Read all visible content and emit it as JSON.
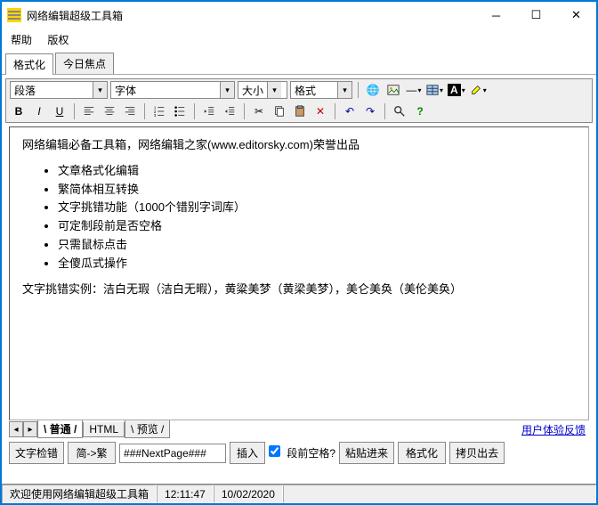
{
  "window": {
    "title": "网络编辑超级工具箱"
  },
  "menu": {
    "help": "帮助",
    "copyright": "版权"
  },
  "top_tabs": {
    "format": "格式化",
    "today": "今日焦点"
  },
  "combos": {
    "paragraph": "段落",
    "font": "字体",
    "size": "大小",
    "style": "格式"
  },
  "content": {
    "intro": "网络编辑必备工具箱，网络编辑之家(www.editorsky.com)荣誉出品",
    "bullets": [
      "文章格式化编辑",
      "繁简体相互转换",
      "文字挑错功能（1000个错别字词库）",
      "可定制段前是否空格",
      "只需鼠标点击",
      "全傻瓜式操作"
    ],
    "example": "文字挑错实例：洁白无瑕（洁白无暇），黄粱美梦（黄梁美梦），美仑美奂（美伦美奂）"
  },
  "bottom_tabs": {
    "normal": "普通",
    "html": "HTML",
    "preview": "预览"
  },
  "feedback": "用户体验反馈",
  "buttons": {
    "check": "文字检错",
    "s2t": "简->繁",
    "pagebreak": "###NextPage###",
    "insert": "插入",
    "indent": "段前空格?",
    "paste": "粘贴进来",
    "format": "格式化",
    "copy": "拷贝出去"
  },
  "status": {
    "welcome": "欢迎使用网络编辑超级工具箱",
    "time": "12:11:47",
    "date": "10/02/2020"
  }
}
